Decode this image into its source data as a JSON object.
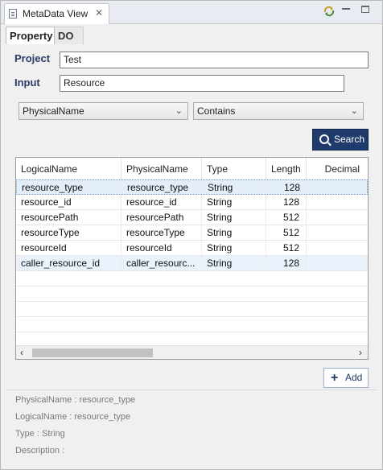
{
  "view": {
    "title": "MetaData View",
    "close_glyph": "✕",
    "toolbar": {
      "sync_icon": "sync-icon",
      "minimize_icon": "minimize-icon",
      "maximize_icon": "maximize-icon"
    }
  },
  "tabs": [
    {
      "label": "Property",
      "active": true
    },
    {
      "label": "DO",
      "active": false
    }
  ],
  "form": {
    "project_label": "Project",
    "project_value": "Test",
    "input_label": "Input",
    "input_value": "Resource",
    "filter_field": "PhysicalName",
    "filter_op": "Contains",
    "search_label": "Search"
  },
  "table": {
    "columns": [
      "LogicalName",
      "PhysicalName",
      "Type",
      "Length",
      "Decimal"
    ],
    "rows": [
      [
        "resource_type",
        "resource_type",
        "String",
        "128",
        ""
      ],
      [
        "resource_id",
        "resource_id",
        "String",
        "128",
        ""
      ],
      [
        "resourcePath",
        "resourcePath",
        "String",
        "512",
        ""
      ],
      [
        "resourceType",
        "resourceType",
        "String",
        "512",
        ""
      ],
      [
        "resourceId",
        "resourceId",
        "String",
        "512",
        ""
      ],
      [
        "caller_resource_id",
        "caller_resourc...",
        "String",
        "128",
        ""
      ]
    ]
  },
  "add_label": "Add",
  "details": {
    "physical": "PhysicalName : resource_type",
    "logical": "LogicalName : resource_type",
    "type": "Type : String",
    "description": "Description :"
  }
}
